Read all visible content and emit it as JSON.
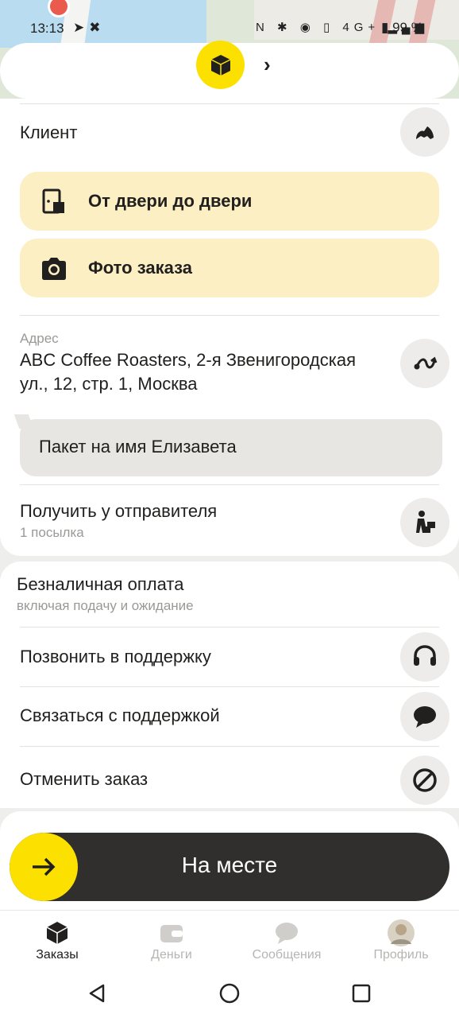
{
  "status_bar": {
    "time": "13:13",
    "battery": "99 %",
    "network": "4G+"
  },
  "header": {
    "logo_icon": "box-icon",
    "chevron": "›"
  },
  "client": {
    "title": "Клиент",
    "icon": "phone-icon"
  },
  "actions": [
    {
      "label": "От двери до двери",
      "icon": "door-box-icon"
    },
    {
      "label": "Фото заказа",
      "icon": "camera-icon"
    }
  ],
  "address": {
    "caption": "Адрес",
    "line1": "ABC Coffee Roasters, 2-я Звенигородская",
    "line2": "ул., 12, стр. 1, Москва",
    "icon": "route-icon"
  },
  "comment": "Пакет на имя Елизавета",
  "pickup": {
    "title": "Получить у отправителя",
    "subtitle": "1 посылка",
    "icon": "person-box-icon"
  },
  "payment": {
    "title": "Безналичная оплата",
    "subtitle": "включая подачу и ожидание"
  },
  "support": [
    {
      "label": "Позвонить в поддержку",
      "icon": "headset-icon"
    },
    {
      "label": "Связаться с поддержкой",
      "icon": "chat-icon"
    },
    {
      "label": "Отменить заказ",
      "icon": "cancel-icon"
    }
  ],
  "slider": {
    "label": "На месте",
    "icon": "arrow-right-icon"
  },
  "tabs": [
    {
      "label": "Заказы",
      "active": true
    },
    {
      "label": "Деньги",
      "active": false
    },
    {
      "label": "Сообщения",
      "active": false
    },
    {
      "label": "Профиль",
      "active": false
    }
  ],
  "colors": {
    "accent_yellow": "#fce000",
    "action_bg": "#fdefc4",
    "slider_bg": "#302f2d"
  }
}
